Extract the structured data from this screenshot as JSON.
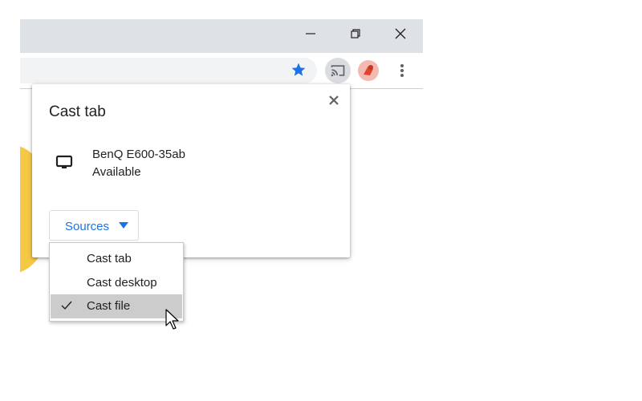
{
  "window_controls": {
    "minimize_icon": "minimize-icon",
    "restore_icon": "restore-icon",
    "close_icon": "close-icon"
  },
  "toolbar": {
    "bookmark_icon": "star-icon",
    "cast_icon": "cast-icon",
    "extension_icon": "extension-icon",
    "menu_icon": "more-vert-icon"
  },
  "dialog": {
    "title": "Cast tab",
    "close_icon": "close-icon",
    "sink": {
      "icon": "monitor-icon",
      "name": "BenQ E600-35ab",
      "status": "Available"
    },
    "sources_button": {
      "label": "Sources",
      "icon": "caret-down-icon"
    }
  },
  "sources_menu": {
    "items": [
      {
        "label": "Cast tab",
        "checked": false
      },
      {
        "label": "Cast desktop",
        "checked": false
      },
      {
        "label": "Cast file",
        "checked": true
      }
    ]
  },
  "colors": {
    "accent": "#1a73e8",
    "chrome": "#dee1e6",
    "selected_row": "#cccccc"
  }
}
